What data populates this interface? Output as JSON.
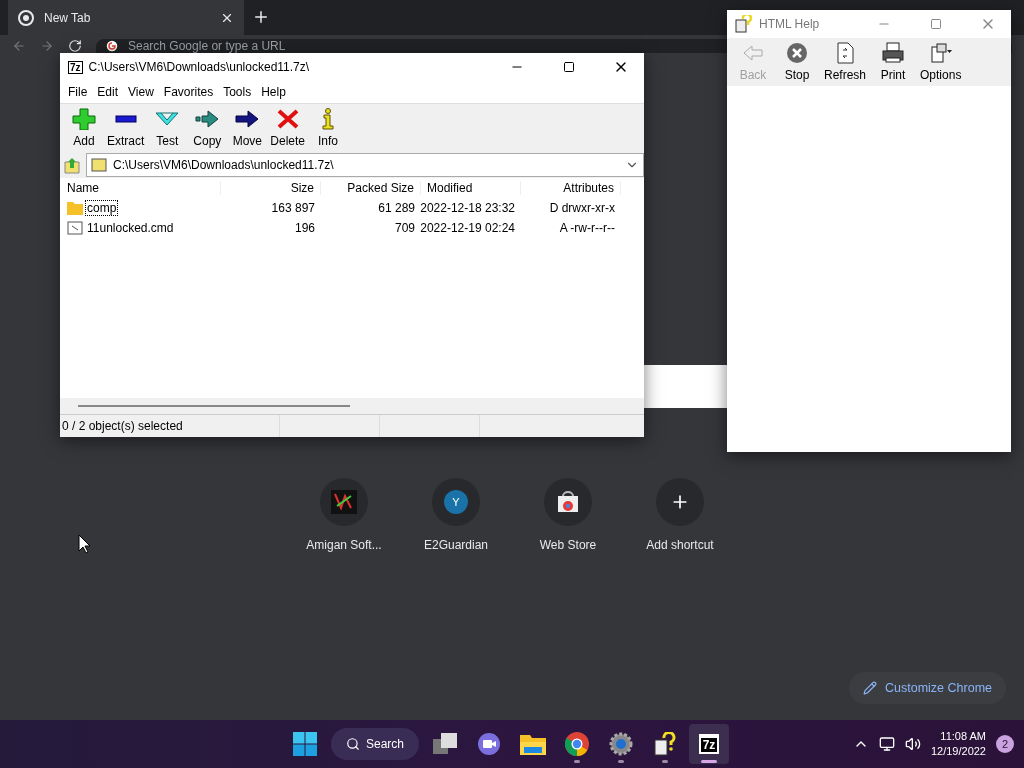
{
  "browser": {
    "tab": {
      "title": "New Tab",
      "selected": true
    },
    "omnibox": {
      "placeholder": "Search Google or type a URL"
    },
    "shortcuts": [
      {
        "label": "Amigan Soft...",
        "kind": "logo"
      },
      {
        "label": "E2Guardian",
        "kind": "letter",
        "letter": "Y"
      },
      {
        "label": "Web Store",
        "kind": "store"
      },
      {
        "label": "Add shortcut",
        "kind": "add"
      }
    ],
    "customize_button": "Customize Chrome"
  },
  "archive_window": {
    "logo_text": "7z",
    "title": "C:\\Users\\VM6\\Downloads\\unlocked11.7z\\",
    "menu": [
      "File",
      "Edit",
      "View",
      "Favorites",
      "Tools",
      "Help"
    ],
    "toolbar": [
      {
        "label": "Add",
        "kind": "add"
      },
      {
        "label": "Extract",
        "kind": "extract"
      },
      {
        "label": "Test",
        "kind": "test"
      },
      {
        "label": "Copy",
        "kind": "copy"
      },
      {
        "label": "Move",
        "kind": "move"
      },
      {
        "label": "Delete",
        "kind": "delete"
      },
      {
        "label": "Info",
        "kind": "info"
      }
    ],
    "path": "C:\\Users\\VM6\\Downloads\\unlocked11.7z\\",
    "columns": [
      "Name",
      "Size",
      "Packed Size",
      "Modified",
      "Attributes"
    ],
    "rows": [
      {
        "kind": "folder",
        "focused": true,
        "cells": [
          "comp",
          "163 897",
          "61 289",
          "2022-12-18 23:32",
          "D drwxr-xr-x"
        ]
      },
      {
        "kind": "file",
        "focused": false,
        "cells": [
          "11unlocked.cmd",
          "196",
          "709",
          "2022-12-19 02:24",
          "A -rw-r--r--"
        ]
      }
    ],
    "status": "0 / 2 object(s) selected"
  },
  "help_window": {
    "title": "HTML Help",
    "toolbar": [
      {
        "label": "Back",
        "kind": "back",
        "disabled": true
      },
      {
        "label": "Stop",
        "kind": "stop",
        "disabled": false
      },
      {
        "label": "Refresh",
        "kind": "refresh",
        "disabled": false
      },
      {
        "label": "Print",
        "kind": "print",
        "disabled": false
      },
      {
        "label": "Options",
        "kind": "options",
        "disabled": false
      }
    ]
  },
  "taskbar": {
    "search": "Search",
    "app_logo_text": "7z",
    "apps": [
      {
        "kind": "windows",
        "running": false,
        "active": false
      },
      {
        "kind": "taskview",
        "running": false,
        "active": false
      },
      {
        "kind": "chat",
        "running": false,
        "active": false
      },
      {
        "kind": "explorer",
        "running": false,
        "active": false
      },
      {
        "kind": "chrome",
        "running": true,
        "active": false
      },
      {
        "kind": "settings",
        "running": true,
        "active": false
      },
      {
        "kind": "help",
        "running": true,
        "active": false
      },
      {
        "kind": "sevenzip",
        "running": true,
        "active": true
      }
    ],
    "time": "11:08 AM",
    "date": "12/19/2022",
    "notifications": "2"
  }
}
